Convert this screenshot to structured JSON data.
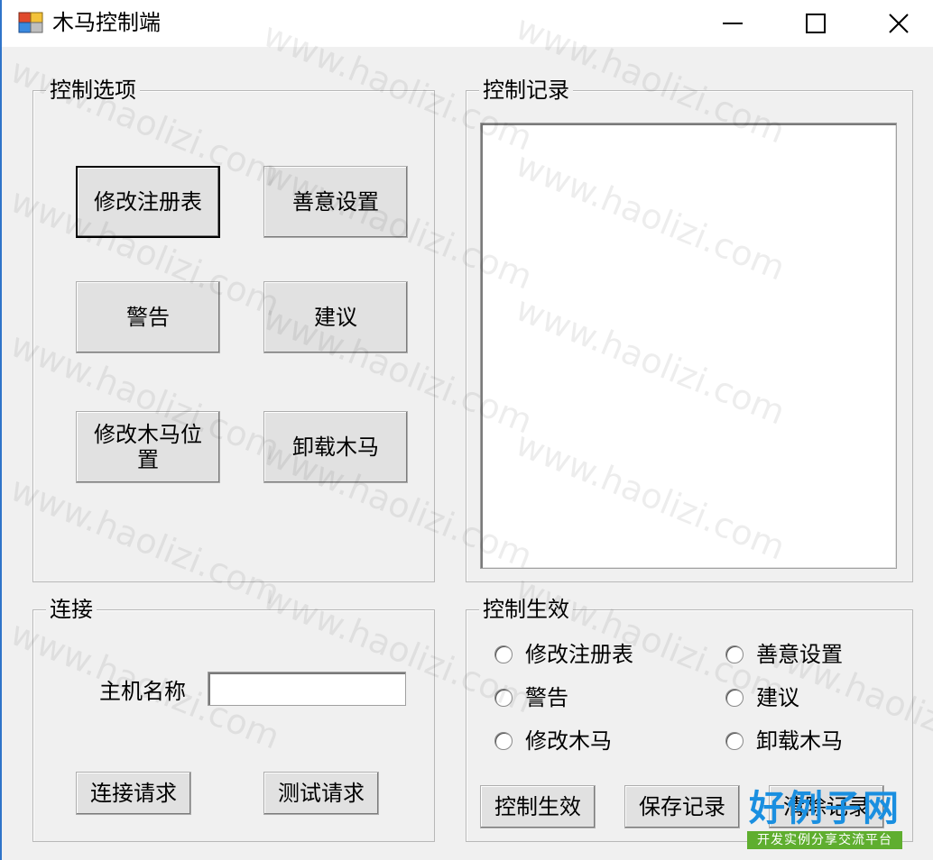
{
  "window": {
    "title": "木马控制端"
  },
  "groups": {
    "options": {
      "legend": "控制选项"
    },
    "log": {
      "legend": "控制记录"
    },
    "connect": {
      "legend": "连接"
    },
    "apply": {
      "legend": "控制生效"
    }
  },
  "options_buttons": {
    "modify_registry": "修改注册表",
    "malicious_settings": "善意设置",
    "warning": "警告",
    "suggestion": "建议",
    "modify_trojan_position": "修改木马位置",
    "uninstall_trojan": "卸载木马"
  },
  "connect": {
    "host_label": "主机名称",
    "host_value": "",
    "connect_button": "连接请求",
    "test_button": "测试请求"
  },
  "apply": {
    "radios": [
      "修改注册表",
      "善意设置",
      "警告",
      "建议",
      "修改木马",
      "卸载木马"
    ],
    "apply_button": "控制生效",
    "save_button": "保存记录",
    "clear_button": "清除记录"
  },
  "watermark": {
    "text": "www.haolizi.com"
  },
  "logo": {
    "main": "好例子网",
    "sub": "开发实例分享交流平台"
  }
}
